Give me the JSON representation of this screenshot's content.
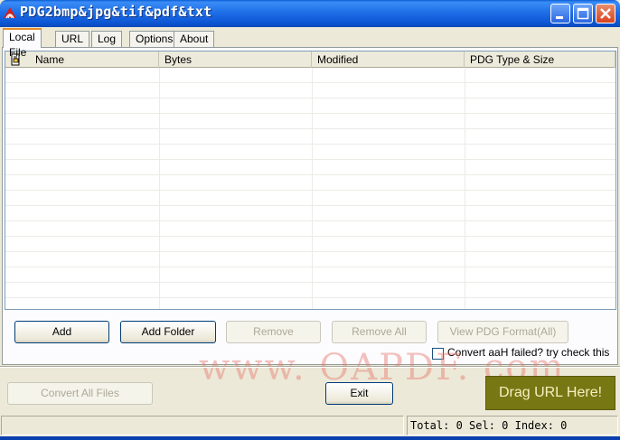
{
  "window": {
    "title": "PDG2bmp&jpg&tif&pdf&txt",
    "controls": {
      "minimize": "minimize-icon",
      "maximize": "maximize-icon",
      "close": "close-icon"
    }
  },
  "tabs": [
    {
      "label": "Local File",
      "active": true
    },
    {
      "label": "URL"
    },
    {
      "label": "Log"
    },
    {
      "label": "Options"
    },
    {
      "label": "About"
    }
  ],
  "list": {
    "header_icon": "hand-pointer-icon",
    "columns": [
      "Name",
      "Bytes",
      "Modified",
      "PDG Type & Size"
    ],
    "rows": []
  },
  "buttons": {
    "add": "Add",
    "add_folder": "Add Folder",
    "remove": "Remove",
    "remove_all": "Remove All",
    "view_pdg_format": "View PDG Format(All)",
    "convert_all": "Convert All Files",
    "exit": "Exit"
  },
  "options": {
    "convert_aah_label": "Convert aaH failed? try check this",
    "convert_aah_checked": false
  },
  "drag_url": "Drag URL Here!",
  "watermark": "www. OAPDF. com",
  "status": {
    "text": "Total: 0 Sel: 0 Index: 0"
  },
  "colors": {
    "title_bar": "#0a5fd6",
    "drag_box": "#777714",
    "watermark": "#e6786e",
    "active_tab_accent": "#e68b2c"
  }
}
